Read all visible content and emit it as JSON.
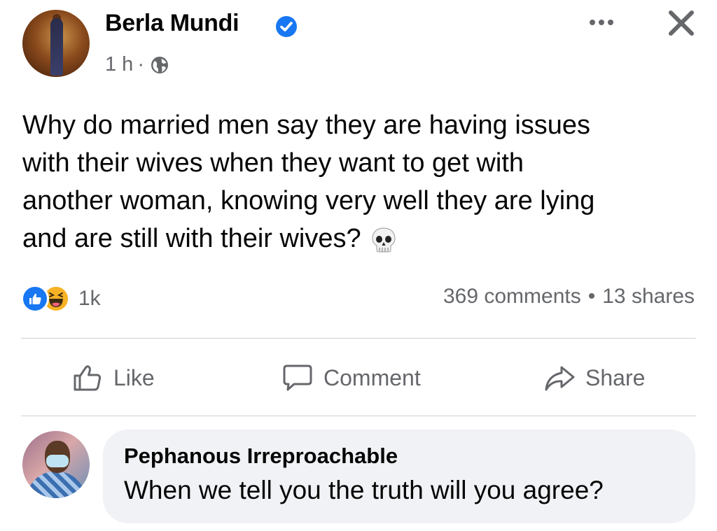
{
  "post": {
    "author": "Berla Mundi",
    "time": "1 h",
    "separator": "·",
    "text_lines": [
      "Why do married men say they are having issues",
      "with their wives when they want to get with",
      "another woman, knowing very well they are lying",
      "and are still with their wives?"
    ],
    "reaction_count": "1k",
    "comments": "369 comments",
    "stats_separator": "•",
    "shares": "13 shares"
  },
  "actions": {
    "like": "Like",
    "comment": "Comment",
    "share": "Share"
  },
  "comment": {
    "author": "Pephanous Irreproachable",
    "text": "When we tell you the truth will you agree?"
  },
  "icons": {
    "verified": "verified-badge-icon",
    "privacy": "globe-icon",
    "more": "more-options-icon",
    "close": "close-icon",
    "reaction_like": "like-reaction-icon",
    "reaction_haha": "haha-reaction-icon",
    "skull_emoji": "skull-emoji"
  },
  "colors": {
    "accent": "#1877f2",
    "secondary_text": "#65676b",
    "bubble": "#f0f2f5",
    "divider": "#ced0d4"
  }
}
